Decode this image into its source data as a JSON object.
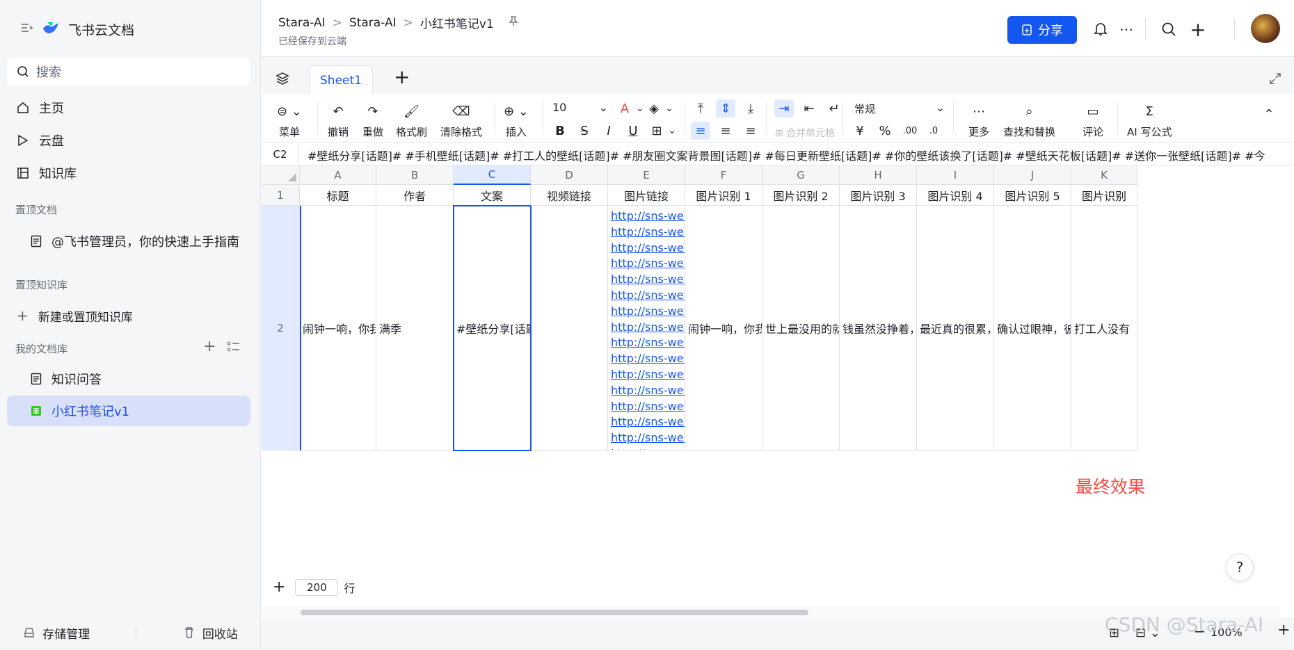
{
  "sidebar": {
    "brand": "飞书云文档",
    "search_placeholder": "搜索",
    "nav": [
      "主页",
      "云盘",
      "知识库"
    ],
    "pinned_docs_title": "置顶文档",
    "pinned_doc": "@飞书管理员，你的快速上手指南",
    "pinned_wiki_title": "置顶知识库",
    "new_wiki": "新建或置顶知识库",
    "my_library_title": "我的文档库",
    "library_items": [
      "知识问答",
      "小红书笔记v1"
    ],
    "storage": "存储管理",
    "trash": "回收站"
  },
  "header": {
    "crumbs": [
      "Stara-AI",
      "Stara-AI",
      "小红书笔记v1"
    ],
    "saved_status": "已经保存到云端",
    "share_label": "分享"
  },
  "tabs": {
    "sheet_name": "Sheet1"
  },
  "toolbar": {
    "menu": "菜单",
    "undo": "撤销",
    "redo": "重做",
    "format_painter": "格式刷",
    "clear_format": "清除格式",
    "insert": "插入",
    "font_size": "10",
    "merge": "合并单元格",
    "number_format": "常规",
    "more": "更多",
    "find_replace": "查找和替换",
    "comment": "评论",
    "ai_formula": "AI 写公式"
  },
  "formula_bar": {
    "cell_ref": "C2",
    "content": "#壁纸分享[话题]# #手机壁纸[话题]# #打工人的壁纸[话题]# #朋友圈文案背景图[话题]# #每日更新壁纸[话题]# #你的壁纸该换了[话题]# #壁纸天花板[话题]# #送你一张壁纸[话题]# #今"
  },
  "grid": {
    "columns": [
      "A",
      "B",
      "C",
      "D",
      "E",
      "F",
      "G",
      "H",
      "I",
      "J",
      "K"
    ],
    "rows": [
      "1",
      "2"
    ],
    "headers": [
      "标题",
      "作者",
      "文案",
      "视频链接",
      "图片链接",
      "图片识别 1",
      "图片识别 2",
      "图片识别 3",
      "图片识别 4",
      "图片识别 5",
      "图片识别"
    ],
    "row2": [
      "闹钟一响，你我皆",
      "满季",
      "#壁纸分享[话题]",
      "",
      "",
      "闹钟一响，你我皆",
      "世上最没用的就是",
      "钱虽然没挣着，但",
      "最近真的很累，有",
      "确认过眼神，彼此",
      "打工人没有"
    ],
    "link_text": "http://sns-webpic",
    "link_count": 18,
    "annotation": "最终效果"
  },
  "footer": {
    "row_count": "200",
    "row_unit": "行",
    "zoom": "100%",
    "watermark": "CSDN @Stara-AI"
  }
}
